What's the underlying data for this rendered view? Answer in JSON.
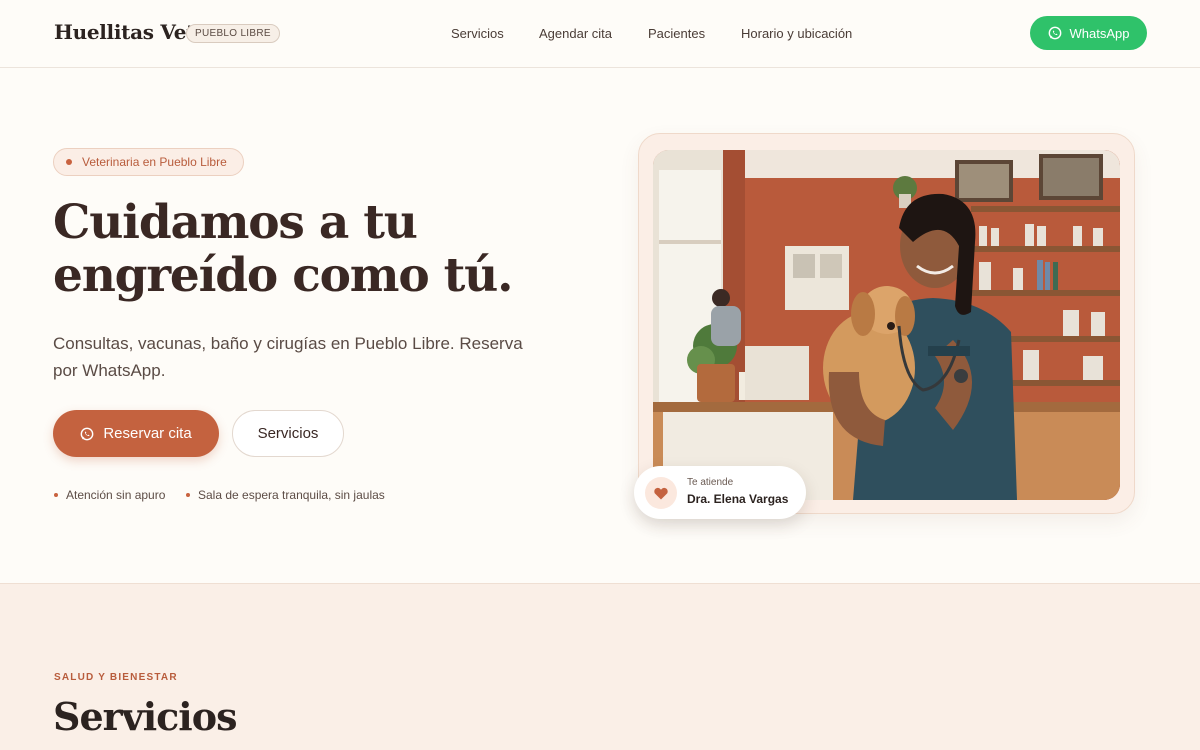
{
  "header": {
    "brand": "Huellitas Vet",
    "badge": "PUEBLO LIBRE",
    "nav": [
      "Servicios",
      "Agendar cita",
      "Pacientes",
      "Horario y ubicación"
    ],
    "whatsapp_label": "WhatsApp"
  },
  "hero": {
    "pill": "Veterinaria en Pueblo Libre",
    "title_line1": "Cuidamos a tu",
    "title_line2": "engreído como tú.",
    "subtitle": "Consultas, vacunas, baño y cirugías en Pueblo Libre. Reserva por WhatsApp.",
    "primary_button": "Reservar cita",
    "secondary_button": "Servicios",
    "features": [
      "Atención sin apuro",
      "Sala de espera tranquila, sin jaulas"
    ],
    "vet_card": {
      "caption": "Te atiende",
      "name": "Dra. Elena Vargas"
    }
  },
  "services": {
    "eyebrow": "SALUD Y BIENESTAR",
    "title": "Servicios"
  },
  "colors": {
    "accent": "#c4623f",
    "whatsapp": "#2fc26a",
    "background": "#fefcf8",
    "section_bg": "#faefe7"
  },
  "icons": [
    "whatsapp-icon",
    "heart-icon"
  ]
}
